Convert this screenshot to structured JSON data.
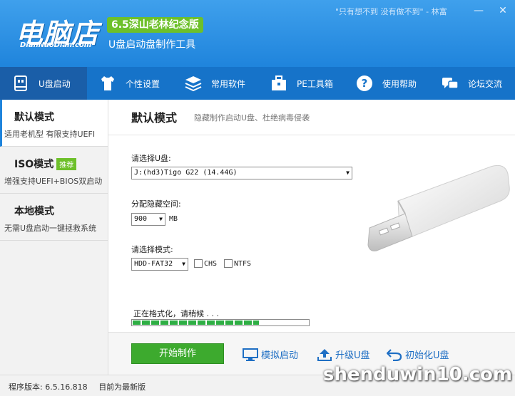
{
  "header": {
    "logo_text": "电脑店",
    "logo_sub": "DianNaoDian.com",
    "version_badge": "6.5深山老林纪念版",
    "subtitle": "U盘启动盘制作工具",
    "slogan": "\"只有想不到  没有做不到\" - 林富",
    "window_buttons": [
      "minimize-icon",
      "close-icon"
    ]
  },
  "nav": {
    "items": [
      {
        "label": "U盘启动",
        "icon": "usb-drive-icon",
        "active": true
      },
      {
        "label": "个性设置",
        "icon": "shirt-icon"
      },
      {
        "label": "常用软件",
        "icon": "layers-icon"
      },
      {
        "label": "PE工具箱",
        "icon": "toolbox-icon"
      },
      {
        "label": "使用帮助",
        "icon": "help-icon"
      },
      {
        "label": "论坛交流",
        "icon": "chat-icon"
      }
    ]
  },
  "sidebar": {
    "modes": [
      {
        "title": "默认模式",
        "desc": "适用老机型 有限支持UEFI",
        "active": true
      },
      {
        "title": "ISO模式",
        "badge": "推荐",
        "desc": "增强支持UEFI+BIOS双启动"
      },
      {
        "title": "本地模式",
        "desc": "无需U盘启动一键拯救系统"
      }
    ]
  },
  "content": {
    "title": "默认模式",
    "description": "隐藏制作启动U盘、杜绝病毒侵袭",
    "select_usb_label": "请选择U盘:",
    "usb_value": "J:(hd3)Tigo G22 (14.44G)",
    "hidden_space_label": "分配隐藏空间:",
    "hidden_space_value": "900",
    "hidden_space_unit": "MB",
    "mode_label": "请选择模式:",
    "mode_value": "HDD-FAT32",
    "chs_label": "CHS",
    "ntfs_label": "NTFS",
    "progress_text": "正在格式化，请稍候 . . .",
    "progress": 0.72
  },
  "actions": {
    "start": "开始制作",
    "simulate": "模拟启动",
    "upgrade": "升级U盘",
    "init": "初始化U盘"
  },
  "status": {
    "version": "程序版本: 6.5.16.818",
    "latest": "目前为最新版"
  },
  "watermark": "shenduwin10.com",
  "colors": {
    "header": "#1f84dc",
    "nav": "#1673c9",
    "accent_green": "#3daa2e",
    "link": "#1f6fc4"
  }
}
